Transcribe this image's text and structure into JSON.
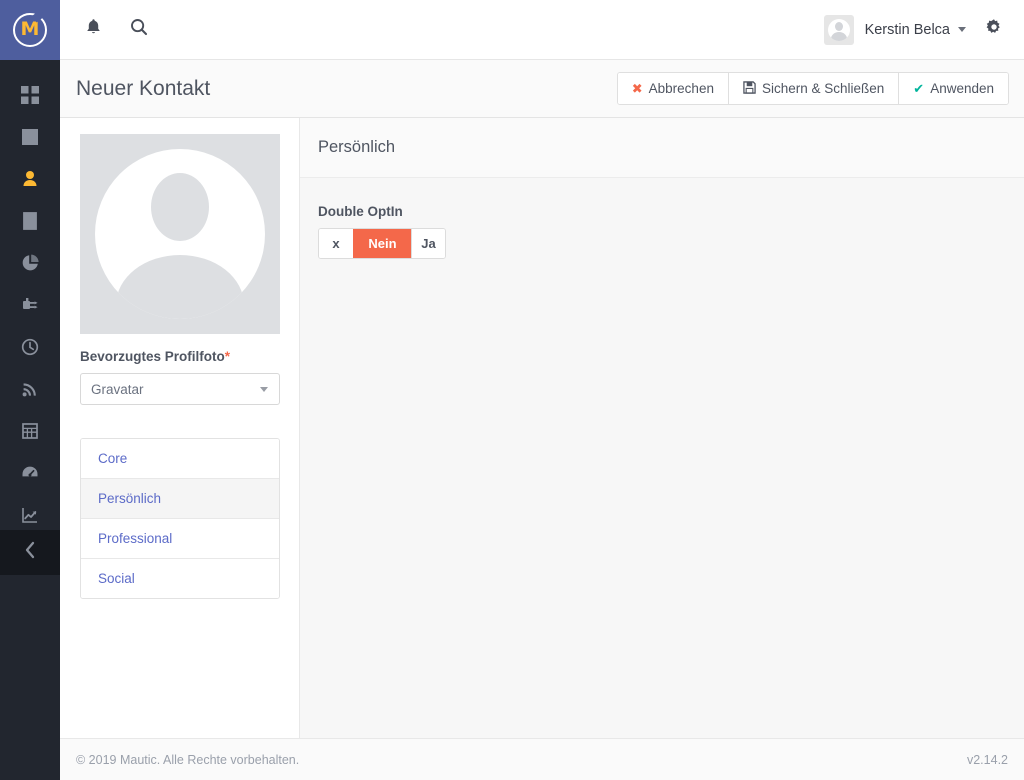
{
  "brand": {
    "logo_icon": "mautic-logo-icon",
    "logo_letter": "M"
  },
  "sidebar": {
    "items": [
      {
        "icon": "dashboard-grid-icon",
        "name": "dashboard",
        "active": false
      },
      {
        "icon": "calendar-icon",
        "name": "calendar",
        "active": false
      },
      {
        "icon": "contacts-person-icon",
        "name": "contacts",
        "active": true
      },
      {
        "icon": "company-building-icon",
        "name": "companies",
        "active": false
      },
      {
        "icon": "pie-chart-icon",
        "name": "reports",
        "active": false
      },
      {
        "icon": "campaign-plug-icon",
        "name": "campaigns",
        "active": false
      },
      {
        "icon": "clock-icon",
        "name": "points",
        "active": false
      },
      {
        "icon": "rss-feed-icon",
        "name": "stages",
        "active": false
      },
      {
        "icon": "table-grid-icon",
        "name": "forms",
        "active": false
      },
      {
        "icon": "gauge-icon",
        "name": "monitoring",
        "active": false
      },
      {
        "icon": "line-chart-icon",
        "name": "analytics",
        "active": false
      }
    ],
    "collapse_icon": "chevron-left-icon"
  },
  "topbar": {
    "notifications_icon": "bell-icon",
    "search_icon": "search-icon",
    "settings_icon": "gear-icon",
    "user": {
      "name": "Kerstin Belca",
      "avatar_icon": "user-avatar-icon",
      "caret_icon": "chevron-down-icon"
    }
  },
  "page": {
    "title": "Neuer Kontakt",
    "actions": [
      {
        "label": "Abbrechen",
        "icon": "times-icon",
        "icon_glyph": "✖",
        "color": "#f4684a",
        "name": "cancel-button"
      },
      {
        "label": "Sichern & Schließen",
        "icon": "save-floppy-icon",
        "icon_glyph": "💾",
        "color": "#4f5561",
        "name": "save-and-close-button"
      },
      {
        "label": "Anwenden",
        "icon": "check-icon",
        "icon_glyph": "✔",
        "color": "#00b49c",
        "name": "apply-button"
      }
    ]
  },
  "left_panel": {
    "avatar_icon": "contact-photo-placeholder-icon",
    "photo_label": "Bevorzugtes Profilfoto",
    "photo_required_marker": "*",
    "photo_select": {
      "value": "Gravatar",
      "caret_icon": "chevron-down-icon"
    },
    "tabs": [
      {
        "label": "Core",
        "active": false
      },
      {
        "label": "Persönlich",
        "active": true
      },
      {
        "label": "Professional",
        "active": false
      },
      {
        "label": "Social",
        "active": false
      }
    ]
  },
  "right_panel": {
    "title": "Persönlich",
    "double_optin": {
      "label": "Double OptIn",
      "options": [
        {
          "label": "x",
          "active": false
        },
        {
          "label": "Nein",
          "active": true
        },
        {
          "label": "Ja",
          "active": false
        }
      ],
      "active_color": "#f4684a"
    }
  },
  "footer": {
    "copyright": "© 2019 Mautic. Alle Rechte vorbehalten.",
    "version": "v2.14.2"
  }
}
